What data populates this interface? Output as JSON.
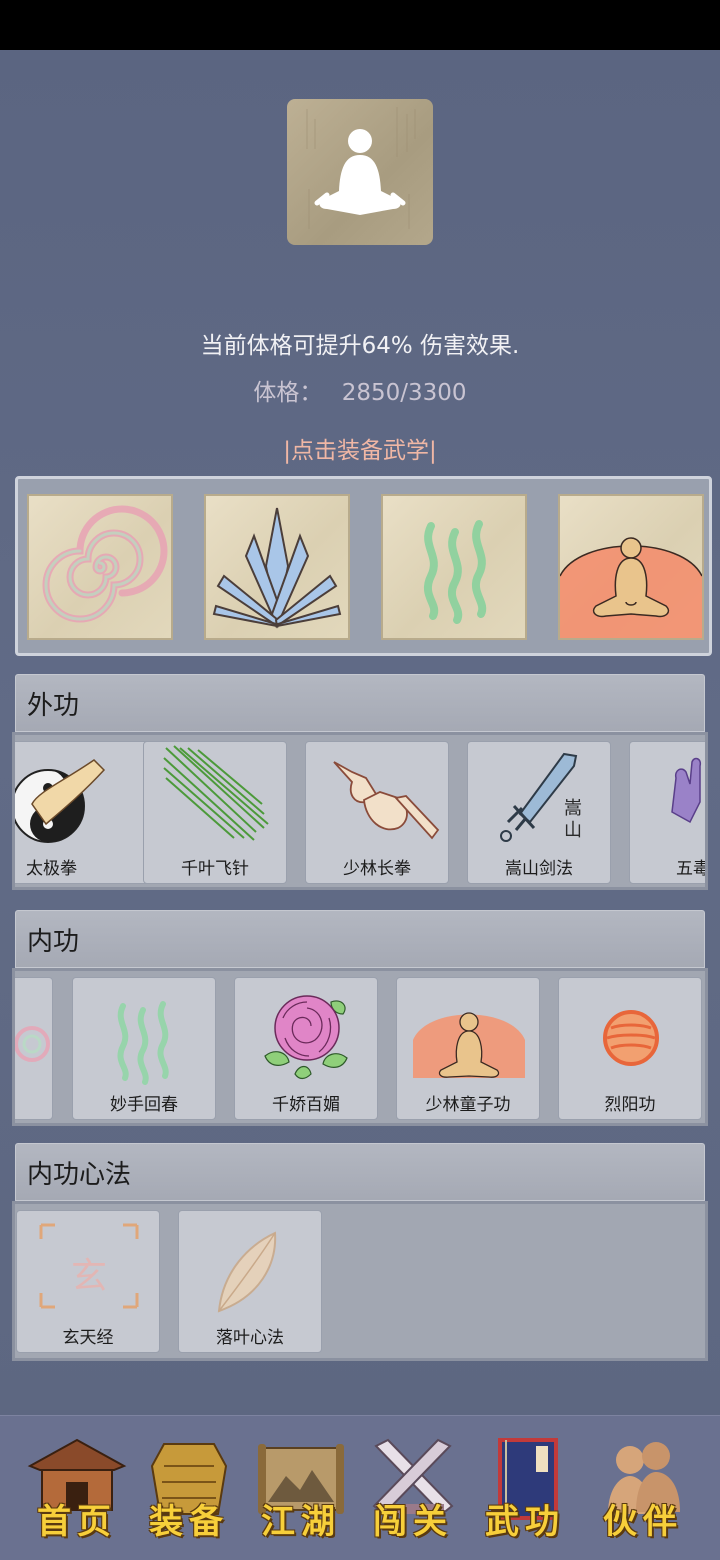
{
  "status_bar": {},
  "header": {
    "boost_text": "当前体格可提升64% 伤害效果.",
    "stat_label": "体格：",
    "stat_value": "2850/3300",
    "equip_hint": "|点击装备武学|"
  },
  "equipped_slots": [
    {
      "icon": "spiral-icon"
    },
    {
      "icon": "ice-crystal-icon"
    },
    {
      "icon": "qi-wave-icon"
    },
    {
      "icon": "meditating-monk-icon"
    }
  ],
  "sections": {
    "outer": {
      "title": "外功",
      "items": [
        {
          "label": "太极拳",
          "icon": "taiji-icon"
        },
        {
          "label": "千叶飞针",
          "icon": "needles-icon"
        },
        {
          "label": "少林长拳",
          "icon": "fists-icon"
        },
        {
          "label": "嵩山剑法",
          "icon": "sword-icon",
          "glyphs": "嵩山"
        },
        {
          "label": "五毒",
          "icon": "poison-hand-icon"
        }
      ]
    },
    "inner": {
      "title": "内功",
      "items": [
        {
          "label": "",
          "icon": "spiral-partial-icon"
        },
        {
          "label": "妙手回春",
          "icon": "qi-wave-icon"
        },
        {
          "label": "千娇百媚",
          "icon": "rose-icon"
        },
        {
          "label": "少林童子功",
          "icon": "meditating-monk-icon"
        },
        {
          "label": "烈阳功",
          "icon": "sun-orb-icon"
        }
      ]
    },
    "mind": {
      "title": "内功心法",
      "items": [
        {
          "label": "玄天经",
          "icon": "xuan-seal-icon",
          "glyph": "玄"
        },
        {
          "label": "落叶心法",
          "icon": "leaf-icon"
        }
      ]
    }
  },
  "bottom_nav": [
    {
      "label": "首页",
      "icon": "temple-icon"
    },
    {
      "label": "装备",
      "icon": "armor-icon"
    },
    {
      "label": "江湖",
      "icon": "scroll-map-icon"
    },
    {
      "label": "闯关",
      "icon": "crossed-swords-icon"
    },
    {
      "label": "武功",
      "icon": "book-icon"
    },
    {
      "label": "伙伴",
      "icon": "companions-icon"
    }
  ],
  "colors": {
    "background": "#5e6883",
    "hint": "#f0b7a5",
    "nav_label": "#f7cf3a"
  }
}
